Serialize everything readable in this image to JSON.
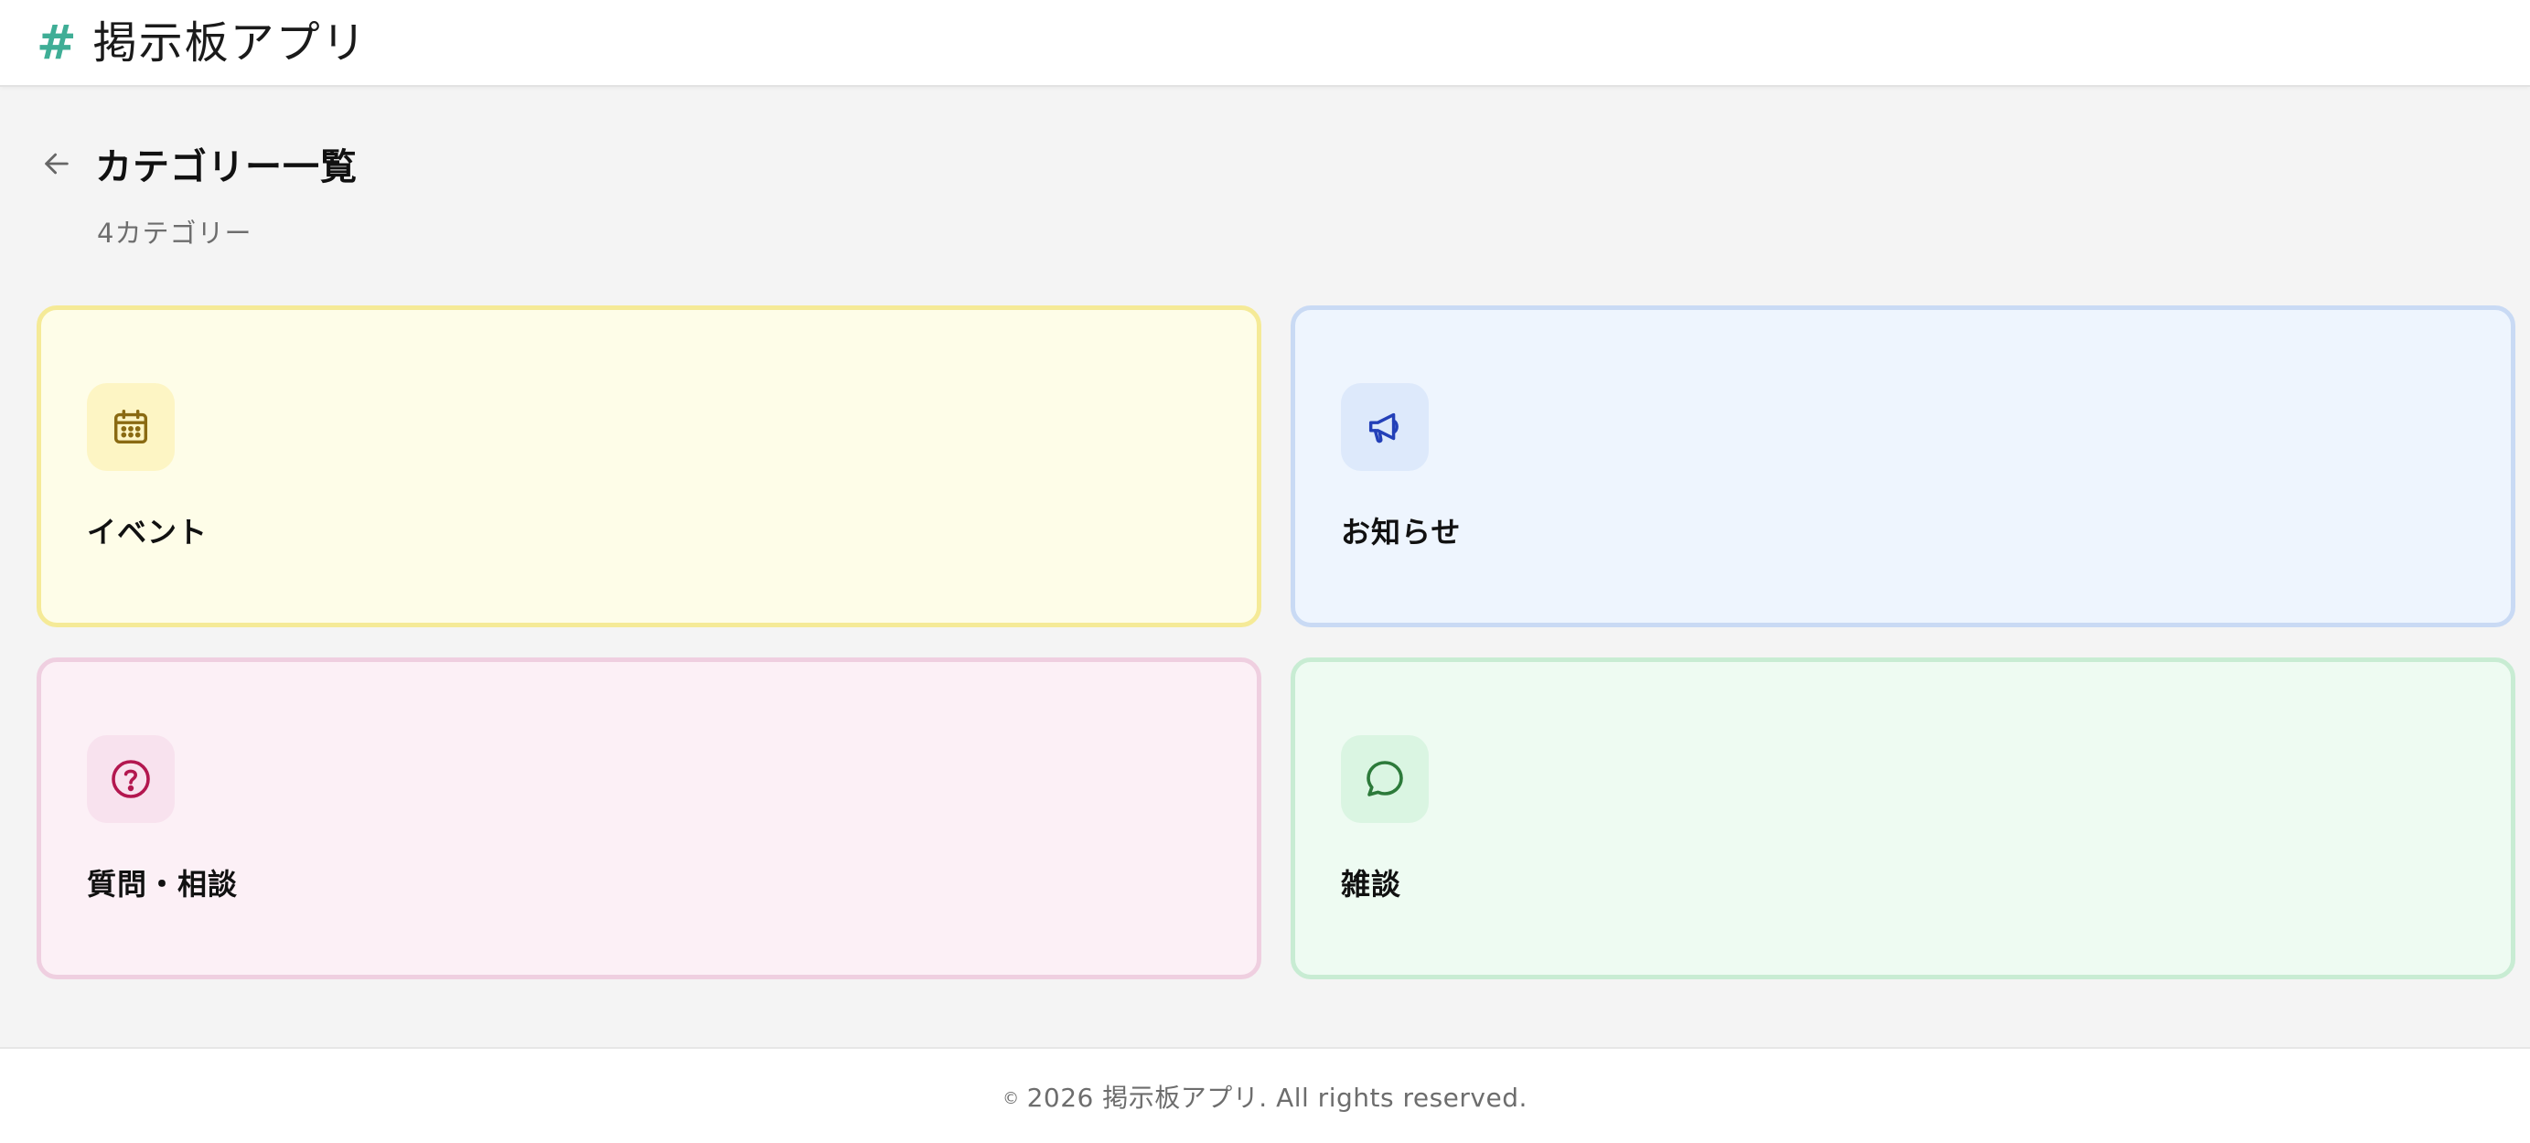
{
  "app": {
    "logo_symbol": "#",
    "title": "掲示板アプリ"
  },
  "page": {
    "back_icon": "arrow-left-icon",
    "title": "カテゴリー一覧",
    "subtitle": "4カテゴリー"
  },
  "categories": [
    {
      "label": "イベント",
      "icon": "calendar-icon",
      "bg": "#fefde8",
      "border": "#f5ea97",
      "icon_color": "#8a6a12"
    },
    {
      "label": "お知らせ",
      "icon": "megaphone-icon",
      "bg": "#eef5fe",
      "border": "#c9daf4",
      "icon_color": "#2340b8"
    },
    {
      "label": "質問・相談",
      "icon": "question-circle-icon",
      "bg": "#fcf0f6",
      "border": "#efcfe0",
      "icon_color": "#b3174f"
    },
    {
      "label": "雑談",
      "icon": "chat-bubble-icon",
      "bg": "#eefbf2",
      "border": "#c8ecd3",
      "icon_color": "#2c7a3a"
    }
  ],
  "footer": {
    "copyright_symbol": "©",
    "text": "2026 掲示板アプリ. All rights reserved."
  },
  "colors": {
    "accent": "#3fae96",
    "page_bg": "#f4f4f4"
  }
}
